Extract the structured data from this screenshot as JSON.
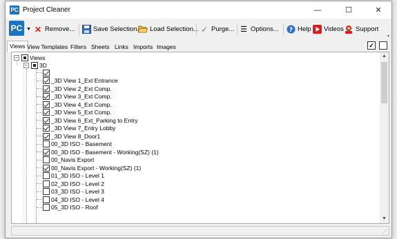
{
  "window": {
    "title": "Project Cleaner",
    "app_icon_text": "PC",
    "minimize": "—",
    "maximize": "☐",
    "close": "✕"
  },
  "toolbar": {
    "logo_text": "PC",
    "remove_label": "Remove...",
    "save_selection_label": "Save Selection...",
    "load_selection_label": "Load Selection...",
    "purge_label": "Purge...",
    "options_label": "Options...",
    "help_label": "Help",
    "videos_label": "Videos",
    "support_label": "Support"
  },
  "tabs": [
    {
      "label": "Views",
      "active": true
    },
    {
      "label": "View Templates",
      "active": false
    },
    {
      "label": "Filters",
      "active": false
    },
    {
      "label": "Sheets",
      "active": false
    },
    {
      "label": "Links",
      "active": false
    },
    {
      "label": "Imports",
      "active": false
    },
    {
      "label": "Images",
      "active": false
    }
  ],
  "tree": {
    "root": {
      "label": "Views",
      "state": "partial",
      "expanded": true
    },
    "group": {
      "label": "3D",
      "state": "partial",
      "expanded": true
    },
    "items": [
      {
        "label": "",
        "state": "checked"
      },
      {
        "label": "_3D View 1_Ext Entrance",
        "state": "checked"
      },
      {
        "label": "_3D View 2_Ext Comp.",
        "state": "checked"
      },
      {
        "label": "_3D View 3_Ext Comp.",
        "state": "checked"
      },
      {
        "label": "_3D View 4_Ext Comp.",
        "state": "checked"
      },
      {
        "label": "_3D View 5_Ext Comp.",
        "state": "checked"
      },
      {
        "label": "_3D View 6_Ext_Parking to Entry",
        "state": "checked"
      },
      {
        "label": "_3D View 7_Entry Lobby",
        "state": "checked"
      },
      {
        "label": "_3D View 8_Door1",
        "state": "checked"
      },
      {
        "label": "00_3D ISO - Basement",
        "state": "unchecked"
      },
      {
        "label": "00_3D ISO - Basement - Working(SZ) (1)",
        "state": "checked"
      },
      {
        "label": "00_Navis Export",
        "state": "unchecked"
      },
      {
        "label": "00_Navis Export - Working(SZ) (1)",
        "state": "checked"
      },
      {
        "label": "01_3D ISO - Level 1",
        "state": "unchecked"
      },
      {
        "label": "02_3D ISO - Level 2",
        "state": "unchecked"
      },
      {
        "label": "03_3D ISO - Level 3",
        "state": "unchecked"
      },
      {
        "label": "04_3D ISO - Level 4",
        "state": "unchecked"
      },
      {
        "label": "05_3D ISO - Roof",
        "state": "unchecked"
      }
    ]
  },
  "icons": {
    "remove": "red-x-icon",
    "save": "floppy-disk-icon",
    "load": "folder-open-icon",
    "purge": "broom-icon",
    "options": "list-icon",
    "help": "help-icon",
    "videos": "play-icon",
    "support": "support-icon"
  },
  "colors": {
    "brand": "#1e73be",
    "remove": "#d42020",
    "videos": "#d42020"
  }
}
